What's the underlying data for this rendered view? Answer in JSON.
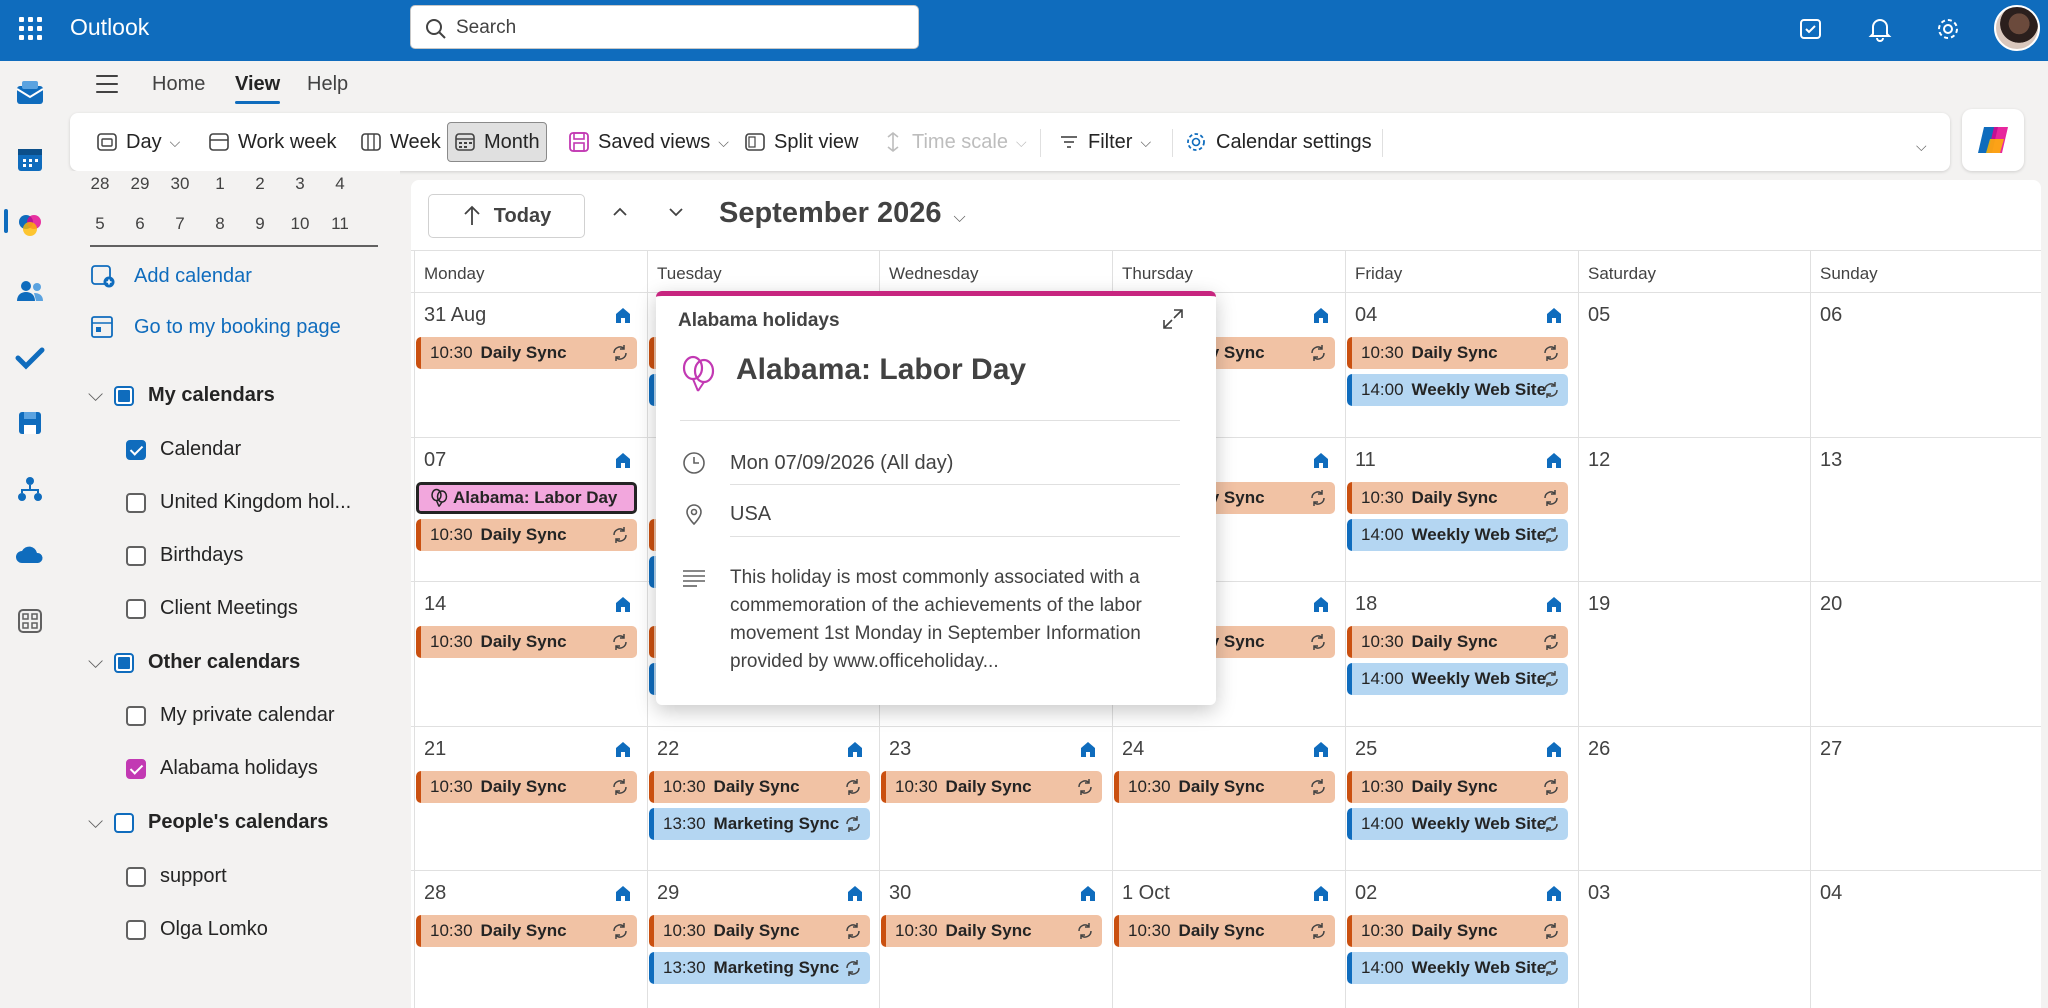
{
  "app": {
    "name": "Outlook"
  },
  "search": {
    "placeholder": "Search"
  },
  "tabs": [
    "Home",
    "View",
    "Help"
  ],
  "ribbon": {
    "day": "Day",
    "work_week": "Work week",
    "week": "Week",
    "month": "Month",
    "saved_views": "Saved views",
    "split_view": "Split view",
    "time_scale": "Time scale",
    "filter": "Filter",
    "calendar_settings": "Calendar settings"
  },
  "mini_calendar": {
    "row1": [
      "28",
      "29",
      "30",
      "1",
      "2",
      "3",
      "4"
    ],
    "row2": [
      "5",
      "6",
      "7",
      "8",
      "9",
      "10",
      "11"
    ]
  },
  "left_panel": {
    "add_calendar": "Add calendar",
    "booking_page": "Go to my booking page",
    "my_calendars": "My calendars",
    "my_items": [
      "Calendar",
      "United Kingdom hol...",
      "Birthdays",
      "Client Meetings"
    ],
    "other_calendars": "Other calendars",
    "other_items": [
      "My private calendar",
      "Alabama holidays"
    ],
    "peoples_calendars": "People's calendars",
    "people_items": [
      "support",
      "Olga Lomko"
    ]
  },
  "calendar": {
    "today_label": "Today",
    "month_title": "September 2026",
    "weekdays": [
      "Monday",
      "Tuesday",
      "Wednesday",
      "Thursday",
      "Friday",
      "Saturday",
      "Sunday"
    ],
    "weeks": [
      [
        "31 Aug",
        "",
        "",
        "",
        "04",
        "05",
        "06"
      ],
      [
        "07",
        "",
        "",
        "",
        "11",
        "12",
        "13"
      ],
      [
        "14",
        "",
        "",
        "",
        "18",
        "19",
        "20"
      ],
      [
        "21",
        "22",
        "23",
        "24",
        "25",
        "26",
        "27"
      ],
      [
        "28",
        "29",
        "30",
        "1 Oct",
        "02",
        "03",
        "04"
      ]
    ],
    "events": {
      "daily_time": "10:30",
      "daily_name": "Daily Sync",
      "web_time": "14:00",
      "web_name": "Weekly Web Site",
      "mkt_time": "13:30",
      "mkt_name": "Marketing Sync",
      "holiday": "Alabama: Labor Day"
    }
  },
  "popup": {
    "calendar_name": "Alabama holidays",
    "title": "Alabama: Labor Day",
    "when": "Mon 07/09/2026 (All day)",
    "where": "USA",
    "description": "This holiday is most commonly associated with a commemoration of the achievements of the labor movement  1st Monday in September Information provided by www.officeholiday..."
  },
  "colors": {
    "brand": "#0f6cbd",
    "daily_sync": "#f1c2a4",
    "weekly_web": "#b4d6f2",
    "holiday": "#f2a7dd",
    "popup_accent": "#c7257f"
  }
}
